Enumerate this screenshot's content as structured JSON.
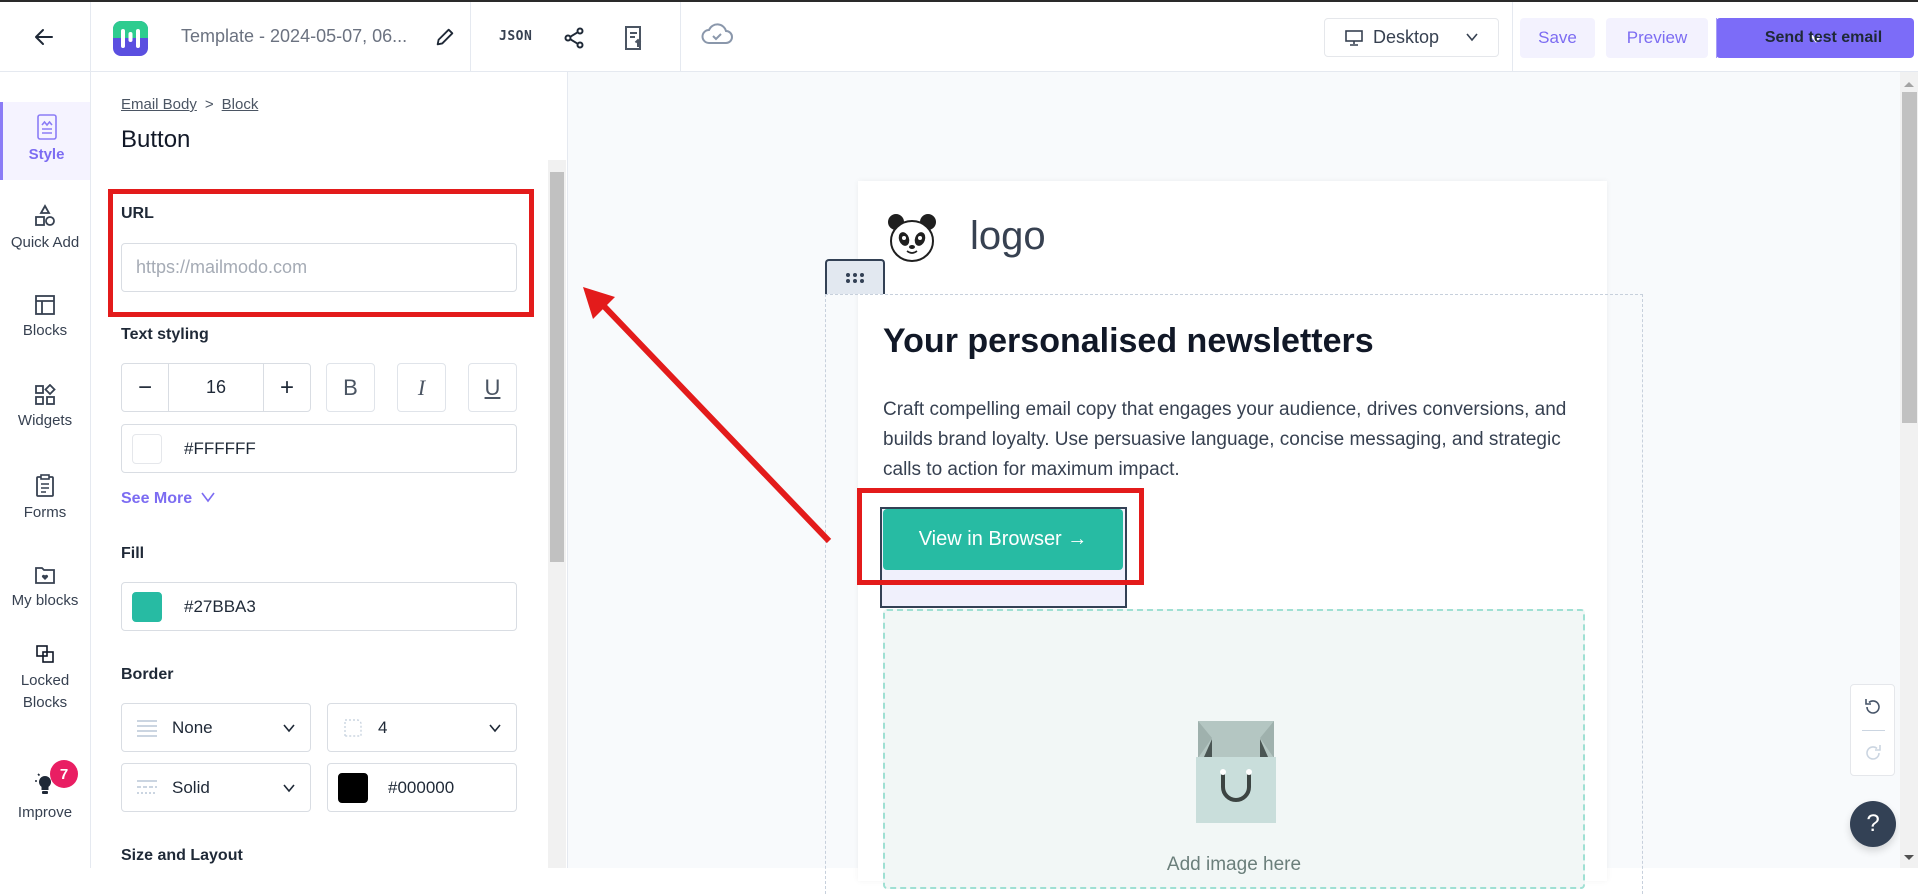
{
  "header": {
    "back_icon": "arrow-left-icon",
    "app_logo": "mailmodo-logo",
    "template_title": "Template - 2024-05-07, 06...",
    "edit_icon": "pencil-icon",
    "json_label": "JSON",
    "share_icon": "share-icon",
    "export_icon": "document-export-icon",
    "save_status_icon": "cloud-check-icon",
    "device_select": {
      "value": "Desktop",
      "icon": "monitor-icon"
    },
    "save_label": "Save",
    "preview_label": "Preview",
    "send_test_label": "Send test email"
  },
  "rail": {
    "items": [
      {
        "label": "Style",
        "icon": "style-icon",
        "active": true
      },
      {
        "label": "Quick Add",
        "icon": "shapes-icon"
      },
      {
        "label": "Blocks",
        "icon": "layout-icon"
      },
      {
        "label": "Widgets",
        "icon": "widgets-icon"
      },
      {
        "label": "Forms",
        "icon": "clipboard-icon"
      },
      {
        "label": "My blocks",
        "icon": "folder-heart-icon"
      },
      {
        "label": "Locked Blocks",
        "icon": "copy-icon"
      },
      {
        "label": "Improve",
        "icon": "bulb-icon",
        "badge": "7"
      }
    ]
  },
  "panel": {
    "breadcrumb": [
      "Email Body",
      "Block"
    ],
    "breadcrumb_sep": ">",
    "title": "Button",
    "url": {
      "label": "URL",
      "value": "",
      "placeholder": "https://mailmodo.com"
    },
    "text_styling": {
      "label": "Text styling",
      "font_size": "16",
      "minus": "−",
      "plus": "+",
      "bold": "B",
      "italic": "I",
      "underline": "U",
      "color": "#FFFFFF"
    },
    "see_more": "See More",
    "fill": {
      "label": "Fill",
      "color": "#27BBA3"
    },
    "border": {
      "label": "Border",
      "type": "None",
      "radius": "4",
      "style": "Solid",
      "color": "#000000"
    },
    "size_layout_label": "Size and Layout"
  },
  "canvas": {
    "logo_text": "logo",
    "heading": "Your personalised newsletters",
    "body": "Craft compelling email copy that engages your audience, drives conversions, and builds brand loyalty. Use persuasive language, concise messaging, and strategic calls to action for maximum impact.",
    "cta_label": "View in Browser →",
    "image_placeholder": "Add image here",
    "help_label": "?"
  },
  "colors": {
    "accent": "#7C6CF8",
    "button_fill": "#27BBA3",
    "annotation": "#E31B1B",
    "badge": "#E91E63"
  }
}
